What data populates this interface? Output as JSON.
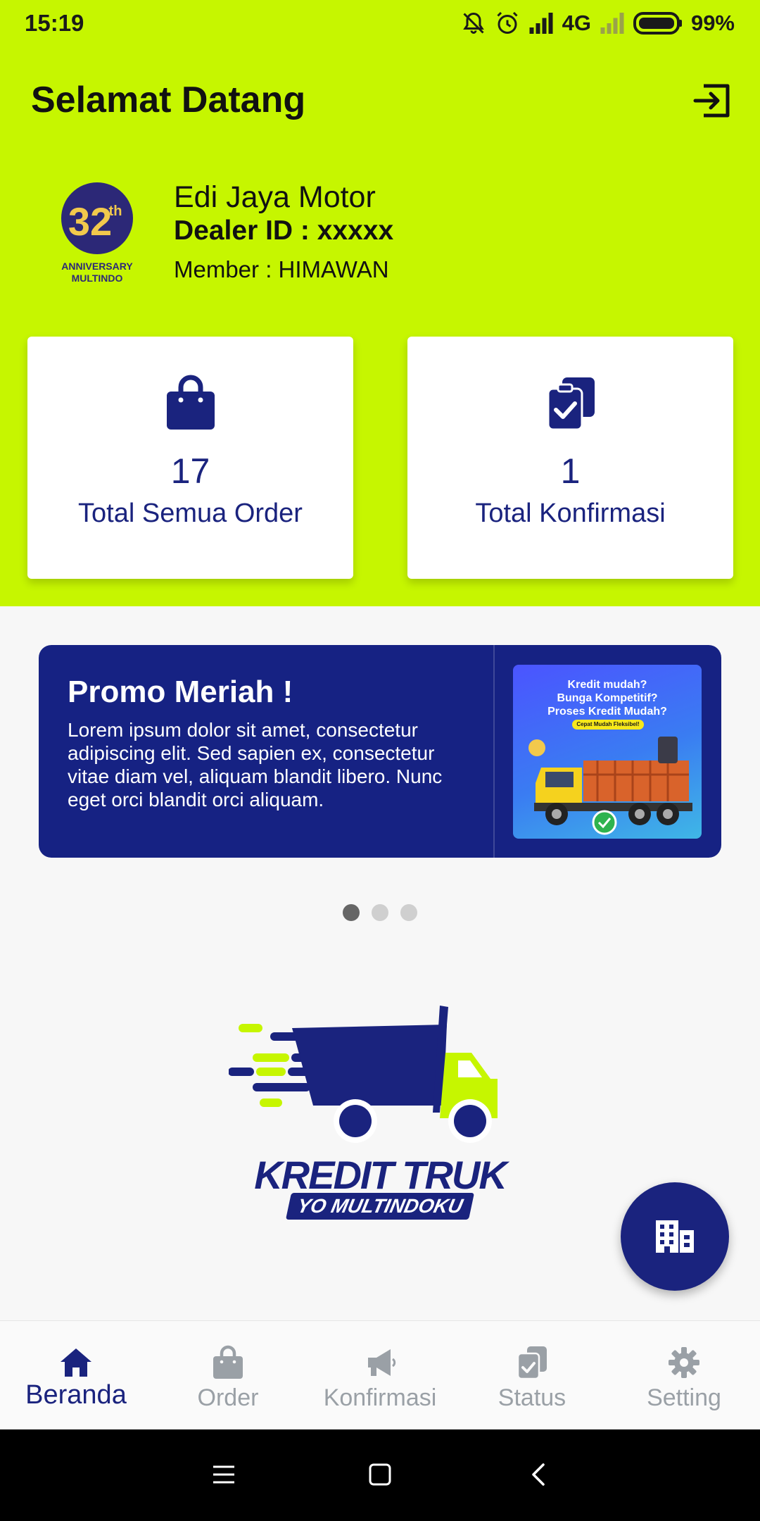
{
  "status_bar": {
    "time": "15:19",
    "network": "4G",
    "battery": "99%",
    "icons": [
      "bell-muted-icon",
      "alarm-icon",
      "signal-icon",
      "signal-weak-icon",
      "battery-icon"
    ]
  },
  "header": {
    "greeting": "Selamat Datang",
    "logout_icon": "logout-icon"
  },
  "logo": {
    "number": "32",
    "suffix": "th",
    "line1": "ANNIVERSARY",
    "line2": "MULTINDO"
  },
  "dealer": {
    "name": "Edi Jaya Motor",
    "id_text": "Dealer ID : xxxxx",
    "member_text": "Member : HIMAWAN"
  },
  "cards": [
    {
      "icon": "shopping-bag-icon",
      "value": "17",
      "label": "Total Semua Order"
    },
    {
      "icon": "clipboard-check-icon",
      "value": "1",
      "label": "Total Konfirmasi"
    }
  ],
  "promo": {
    "title": "Promo Meriah !",
    "body": "Lorem ipsum dolor sit amet, consectetur adipiscing elit. Sed sapien ex, consectetur vitae diam vel, aliquam blandit libero. Nunc eget orci blandit orci aliquam.",
    "image": {
      "line1": "Kredit mudah?",
      "line2": "Bunga Kompetitif?",
      "line3": "Proses Kredit Mudah?",
      "tag": "Cepat Mudah Fleksibel!"
    },
    "slides_total": 3,
    "active_slide": 1
  },
  "brand": {
    "title": "KREDIT TRUK",
    "subtitle": "YO MULTINDOKU"
  },
  "fab": {
    "icon": "building-icon"
  },
  "bottom_nav": [
    {
      "label": "Beranda",
      "icon": "home-icon",
      "active": true
    },
    {
      "label": "Order",
      "icon": "shopping-bag-icon",
      "active": false
    },
    {
      "label": "Konfirmasi",
      "icon": "megaphone-icon",
      "active": false
    },
    {
      "label": "Status",
      "icon": "clipboard-check-icon",
      "active": false
    },
    {
      "label": "Setting",
      "icon": "gear-icon",
      "active": false
    }
  ],
  "colors": {
    "accent": "#c6f600",
    "primary": "#1a237e",
    "nav_inactive": "#9aa0a6"
  }
}
